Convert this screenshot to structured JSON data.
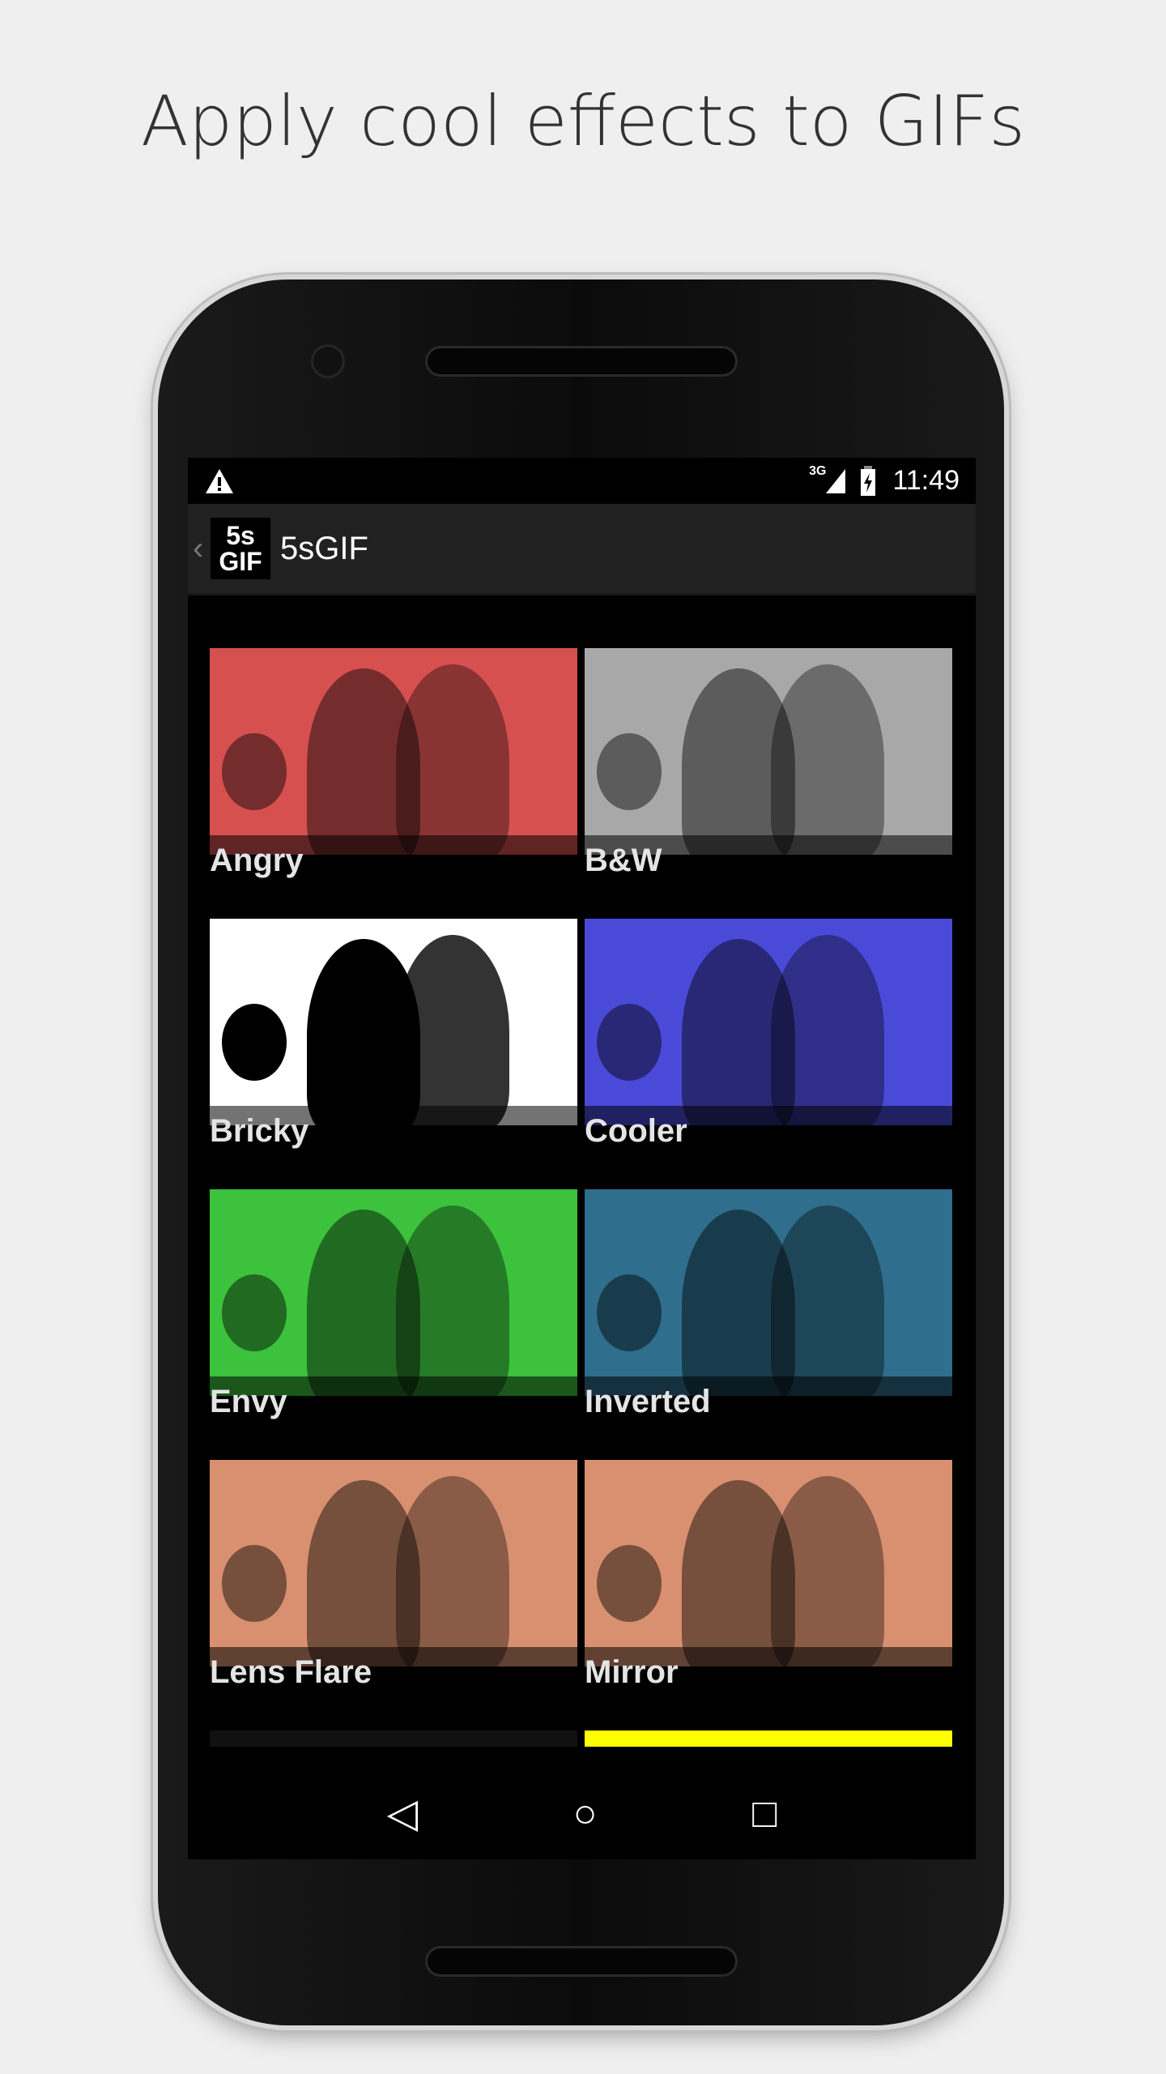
{
  "headline": "Apply cool effects to GIFs",
  "status_bar": {
    "alert_icon": "warning-icon",
    "network": "3G",
    "battery_icon": "battery-charging-icon",
    "time": "11:49"
  },
  "action_bar": {
    "logo_text": [
      "5s",
      "GIF"
    ],
    "title": "5sGIF"
  },
  "effects": [
    {
      "label": "Angry",
      "color": "#d65050"
    },
    {
      "label": "B&W",
      "color": "#a8a8a8"
    },
    {
      "label": "Bricky",
      "color": "#ffffff"
    },
    {
      "label": "Cooler",
      "color": "#4a4ad8"
    },
    {
      "label": "Envy",
      "color": "#3cc23c"
    },
    {
      "label": "Inverted",
      "color": "#2f6e8c"
    },
    {
      "label": "Lens Flare",
      "color": "#d89070"
    },
    {
      "label": "Mirror",
      "color": "#d89070"
    },
    {
      "label": "",
      "color": "#111111"
    },
    {
      "label": "",
      "color": "#ffff00"
    }
  ],
  "nav": {
    "back": "◁",
    "home": "○",
    "recents": "□"
  }
}
